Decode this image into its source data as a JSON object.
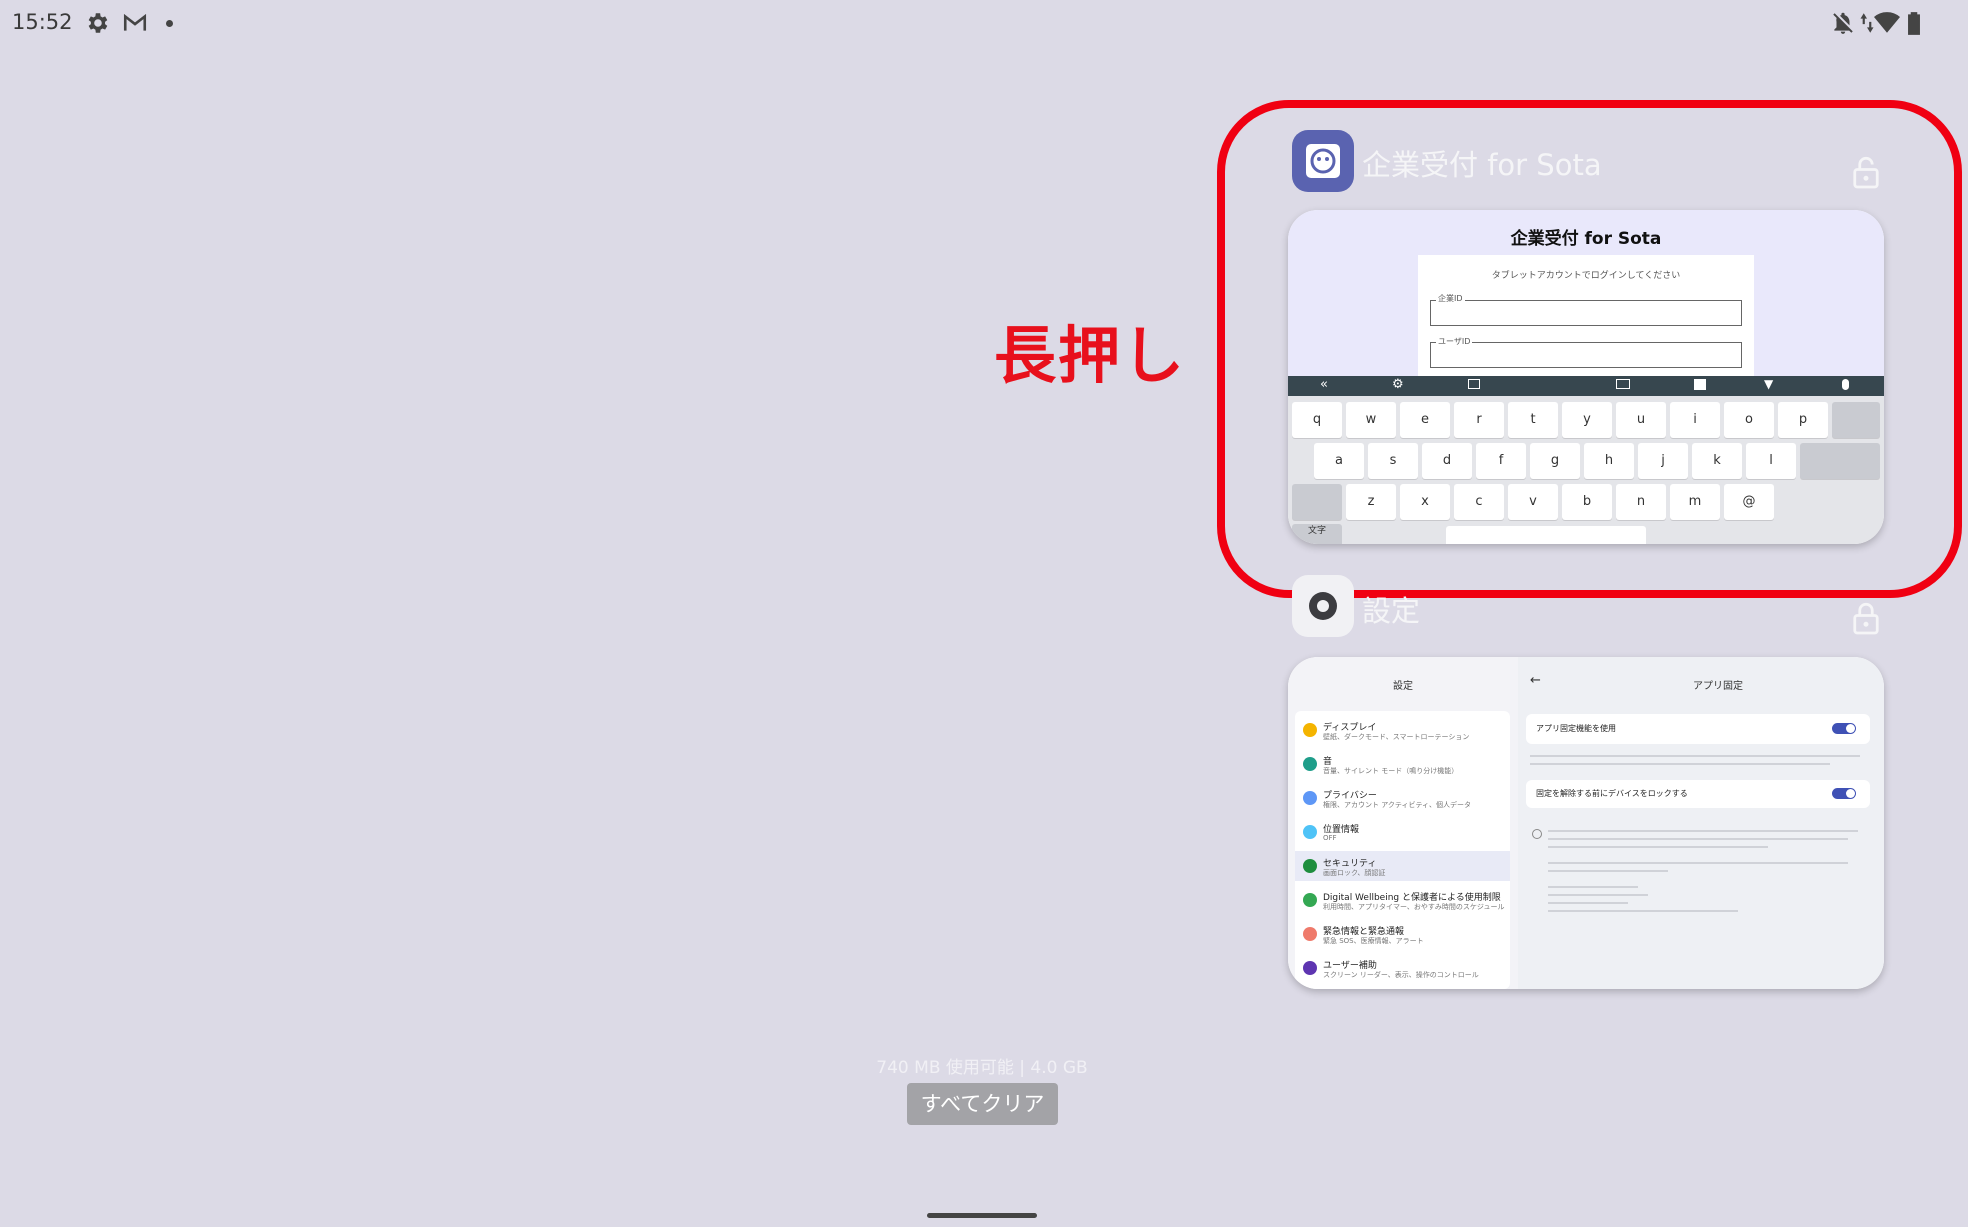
{
  "status_bar": {
    "time": "15:52",
    "left_icons": [
      "gear-icon",
      "gmail-icon",
      "dot-icon"
    ],
    "right_icons": [
      "dnd-off-icon",
      "data-arrows-icon",
      "wifi-icon",
      "battery-icon"
    ]
  },
  "annotation": {
    "label": "長押し",
    "color": "#f00012"
  },
  "recents": [
    {
      "app_title": "企業受付 for Sota",
      "lock_icon": "lock-open-icon",
      "thumbnail": {
        "heading": "企業受付 for Sota",
        "prompt": "タブレットアカウントでログインしてください",
        "field1_label": "企業ID",
        "field2_label": "ユーザID",
        "keyboard_row1": [
          "q",
          "w",
          "e",
          "r",
          "t",
          "y",
          "u",
          "i",
          "o",
          "p"
        ],
        "keyboard_row2": [
          "a",
          "s",
          "d",
          "f",
          "g",
          "h",
          "j",
          "k",
          "l"
        ],
        "keyboard_row3": [
          "z",
          "x",
          "c",
          "v",
          "b",
          "n",
          "m",
          "@"
        ],
        "keyboard_mode": "文字"
      }
    },
    {
      "app_title": "設定",
      "lock_icon": "lock-icon",
      "thumbnail": {
        "left_header": "設定",
        "right_header": "アプリ固定",
        "items": [
          {
            "title": "ディスプレイ",
            "sub": "壁紙、ダークモード、スマートローテーション",
            "color": "#f4b400"
          },
          {
            "title": "音",
            "sub": "音量、サイレント モード（鳴り分け機能）",
            "color": "#1e9e8a"
          },
          {
            "title": "プライバシー",
            "sub": "権限、アカウント アクティビティ、個人データ",
            "color": "#5e97f6"
          },
          {
            "title": "位置情報",
            "sub": "OFF",
            "color": "#4fc3f7"
          },
          {
            "title": "セキュリティ",
            "sub": "画面ロック、顔認証",
            "color": "#1e8e3e"
          },
          {
            "title": "Digital Wellbeing と保護者による使用制限",
            "sub": "利用時間、アプリタイマー、おやすみ時間のスケジュール",
            "color": "#34a853"
          },
          {
            "title": "緊急情報と緊急通報",
            "sub": "緊急 SOS、医療情報、アラート",
            "color": "#ef7a6b"
          },
          {
            "title": "ユーザー補助",
            "sub": "スクリーン リーダー、表示、操作のコントロール",
            "color": "#5e35b1"
          }
        ],
        "toggle1_label": "アプリ固定機能を使用",
        "toggle2_label": "固定を解除する前にデバイスをロックする"
      }
    }
  ],
  "memory_info": "740 MB 使用可能 | 4.0 GB",
  "clear_all_label": "すべてクリア"
}
